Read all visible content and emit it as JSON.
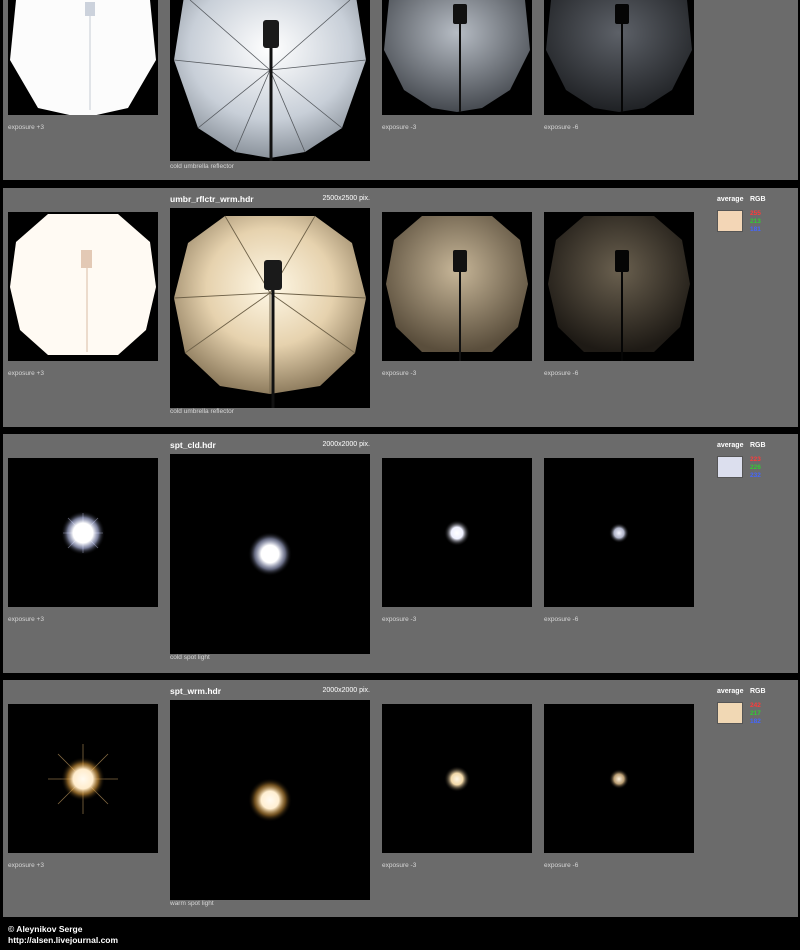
{
  "colors": {
    "panel_bg": "#6b6b6b",
    "page_bg": "#000000",
    "red_value": "#ff3a3a",
    "green_value": "#33cc33",
    "blue_value": "#4466ff"
  },
  "panels": [
    {
      "name": "umbrella-cold",
      "title": "",
      "resolution": "",
      "main_caption": "cold umbrella reflector",
      "thumb_captions": [
        "exposure +3",
        "exposure -3",
        "exposure -6"
      ],
      "has_average": false,
      "tint": "#e4ecff"
    },
    {
      "name": "umbrella-warm",
      "title": "umbr_rflctr_wrm.hdr",
      "resolution": "2500x2500 pix.",
      "main_caption": "cold umbrella reflector",
      "thumb_captions": [
        "exposure +3",
        "exposure -3",
        "exposure -6"
      ],
      "has_average": true,
      "average_label": "average",
      "rgb_label": "RGB",
      "rgb": [
        "255",
        "213",
        "181"
      ],
      "swatch_color": "#f3d6b6",
      "tint": "#fff0d6"
    },
    {
      "name": "spot-cold",
      "title": "spt_cld.hdr",
      "resolution": "2000x2000 pix.",
      "main_caption": "cold spot light",
      "thumb_captions": [
        "exposure +3",
        "exposure -3",
        "exposure -6"
      ],
      "has_average": true,
      "average_label": "average",
      "rgb_label": "RGB",
      "rgb": [
        "223",
        "226",
        "232"
      ],
      "swatch_color": "#dcdfee",
      "tint": "#f0f4ff"
    },
    {
      "name": "spot-warm",
      "title": "spt_wrm.hdr",
      "resolution": "2000x2000 pix.",
      "main_caption": "warm spot light",
      "thumb_captions": [
        "exposure +3",
        "exposure -3",
        "exposure -6"
      ],
      "has_average": true,
      "average_label": "average",
      "rgb_label": "RGB",
      "rgb": [
        "242",
        "217",
        "182"
      ],
      "swatch_color": "#f1d8b4",
      "tint": "#fff0d2"
    }
  ],
  "footer": {
    "author": "© Aleynikov Serge",
    "url": "http://alsen.livejournal.com"
  }
}
